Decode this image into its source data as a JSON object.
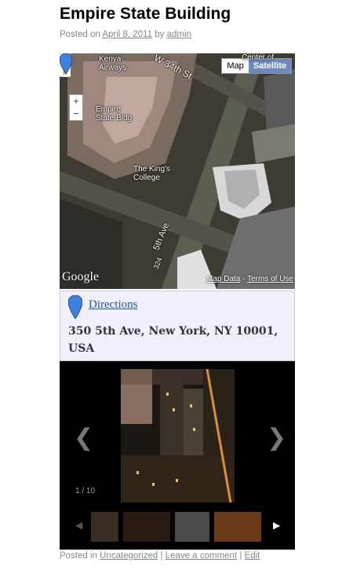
{
  "post": {
    "title": "Empire State Building",
    "posted_on_label": "Posted on",
    "date": "April 8, 2011",
    "by_label": "by",
    "author": "admin"
  },
  "map": {
    "type_map": "Map",
    "type_satellite": "Satellite",
    "zoom_in": "+",
    "zoom_out": "−",
    "labels": {
      "kenya": "Kenya Airways",
      "w34": "W 34th St",
      "esb": "Empire State Bldg",
      "kings": "The King's College",
      "fifth": "5th Ave",
      "num": "324",
      "center": "Center of"
    },
    "logo": "Google",
    "map_data": "Map Data",
    "terms": "Terms of Use"
  },
  "info": {
    "directions": "Directions",
    "address": "350 5th Ave, New York, NY 10001, USA"
  },
  "gallery": {
    "counter": "1 / 10",
    "prev_glyph": "❮",
    "next_glyph": "❯",
    "thumb_prev": "◀",
    "thumb_next": "▶"
  },
  "footer": {
    "posted_in": "Posted in",
    "category": "Uncategorized",
    "sep": "|",
    "leave_comment": "Leave a comment",
    "edit": "Edit"
  },
  "colors": {
    "satellite_active": "#6c8ac2",
    "link": "#2255aa",
    "infobox_bg": "#eff0fb"
  }
}
